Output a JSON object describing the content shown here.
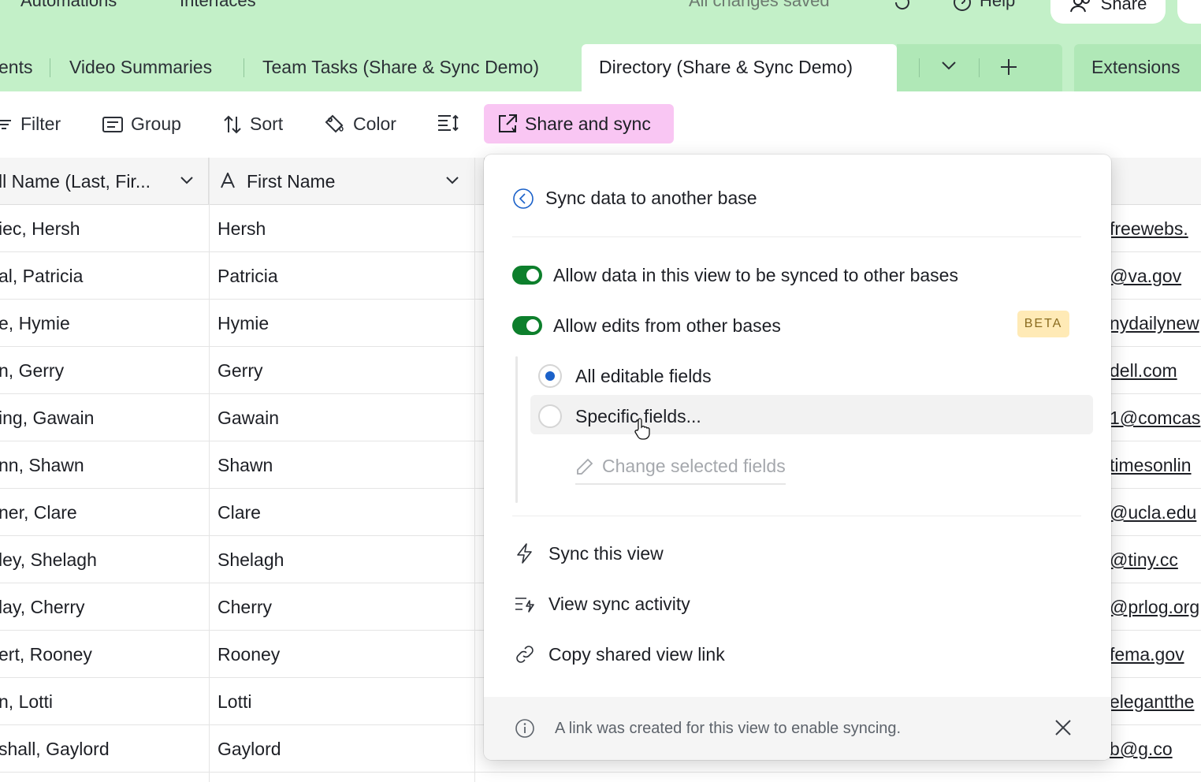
{
  "topbar": {
    "nav": [
      "Automations",
      "Interfaces"
    ],
    "save_status": "All changes saved",
    "help_label": "Help",
    "share_label": "Share"
  },
  "tabs": {
    "items": [
      {
        "label": "ents"
      },
      {
        "label": "Video Summaries"
      },
      {
        "label": "Team Tasks (Share & Sync Demo)"
      },
      {
        "label": "Directory (Share & Sync Demo)",
        "active": true
      }
    ],
    "extensions_label": "Extensions"
  },
  "toolbar": {
    "filter": "Filter",
    "group": "Group",
    "sort": "Sort",
    "color": "Color",
    "share_sync": "Share and sync"
  },
  "grid": {
    "columns": [
      {
        "label": "ll Name (Last, Fir..."
      },
      {
        "label": "First Name"
      }
    ],
    "rows": [
      {
        "full_name": "iec, Hersh",
        "first_name": "Hersh",
        "email": "freewebs."
      },
      {
        "full_name": "al, Patricia",
        "first_name": "Patricia",
        "email": "@va.gov"
      },
      {
        "full_name": "e, Hymie",
        "first_name": "Hymie",
        "email": "nydailynew"
      },
      {
        "full_name": "n, Gerry",
        "first_name": "Gerry",
        "email": "dell.com"
      },
      {
        "full_name": "ing, Gawain",
        "first_name": "Gawain",
        "email": "1@comcas"
      },
      {
        "full_name": "nn, Shawn",
        "first_name": "Shawn",
        "email": "timesonlin"
      },
      {
        "full_name": "ner, Clare",
        "first_name": "Clare",
        "email": "@ucla.edu"
      },
      {
        "full_name": "ley, Shelagh",
        "first_name": "Shelagh",
        "email": "@tiny.cc"
      },
      {
        "full_name": "lay, Cherry",
        "first_name": "Cherry",
        "email": "@prlog.org"
      },
      {
        "full_name": "ert, Rooney",
        "first_name": "Rooney",
        "email": "fema.gov"
      },
      {
        "full_name": "n, Lotti",
        "first_name": "Lotti",
        "email": "elegantthe"
      },
      {
        "full_name": "shall, Gaylord",
        "first_name": "Gaylord",
        "email": "b@g.co"
      }
    ]
  },
  "popover": {
    "title": "Sync data to another base",
    "allow_sync_label": "Allow data in this view to be synced to other bases",
    "allow_sync_on": true,
    "allow_edits_label": "Allow edits from other bases",
    "allow_edits_on": true,
    "beta_badge": "BETA",
    "options": [
      {
        "label": "All editable fields",
        "selected": true
      },
      {
        "label": "Specific fields...",
        "selected": false
      }
    ],
    "change_fields_label": "Change selected fields",
    "menu": [
      {
        "label": "Sync this view",
        "icon": "lightning-icon"
      },
      {
        "label": "View sync activity",
        "icon": "sync-activity-icon"
      },
      {
        "label": "Copy shared view link",
        "icon": "link-icon"
      }
    ],
    "footer_message": "A link was created for this view to enable syncing."
  },
  "colors": {
    "topbar_bg": "#c3f0c8",
    "toggle_on": "#0d7f2c",
    "radio_selected": "#1b61c9",
    "share_sync_bg": "#f9c6f3",
    "beta_bg": "#ffeab6"
  }
}
